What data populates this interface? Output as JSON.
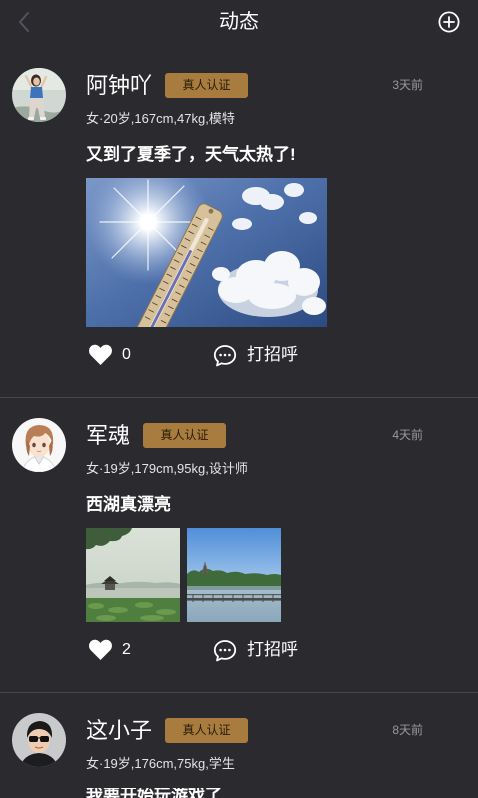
{
  "header": {
    "title": "动态",
    "back_icon": "back-arrow-icon",
    "add_icon": "plus-circle-icon"
  },
  "colors": {
    "background": "#2b2a2f",
    "badge": "#a77c3e",
    "badge_text": "#2a1c08",
    "divider": "#47464b",
    "muted_text": "#9a999e"
  },
  "icons": {
    "like": "heart-icon",
    "greet": "chat-bubble-icon"
  },
  "posts": [
    {
      "name": "阿钟吖",
      "badge": "真人认证",
      "time": "3天前",
      "info": "女·20岁,167cm,47kg,模特",
      "text": "又到了夏季了，天气太热了!",
      "likes": 0,
      "greet_label": "打招呼"
    },
    {
      "name": "军魂",
      "badge": "真人认证",
      "time": "4天前",
      "info": "女·19岁,179cm,95kg,设计师",
      "text": "西湖真漂亮",
      "likes": 2,
      "greet_label": "打招呼"
    },
    {
      "name": "这小子",
      "badge": "真人认证",
      "time": "8天前",
      "info": "女·19岁,176cm,75kg,学生",
      "text": "我要开始玩游戏了"
    }
  ]
}
